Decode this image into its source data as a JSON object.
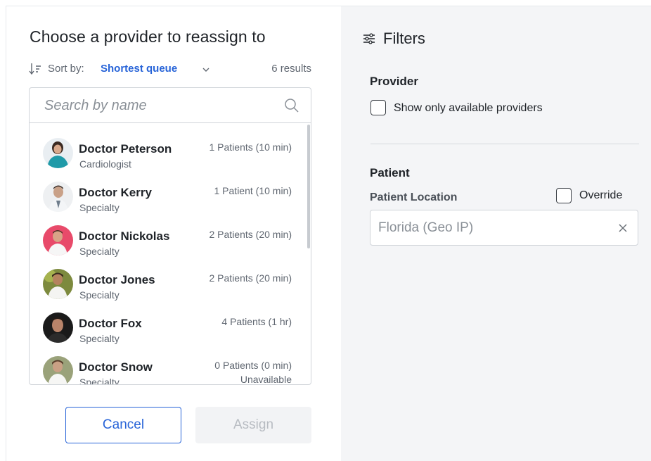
{
  "dialog": {
    "title": "Choose a provider to reassign to",
    "sort": {
      "label": "Sort by:",
      "value": "Shortest queue",
      "results": "6 results"
    },
    "search": {
      "placeholder": "Search by name",
      "value": ""
    },
    "providers": [
      {
        "name": "Doctor Peterson",
        "specialty": "Cardiologist",
        "queue": "1 Patients (10 min)",
        "status": ""
      },
      {
        "name": "Doctor Kerry",
        "specialty": "Specialty",
        "queue": "1 Patient (10 min)",
        "status": ""
      },
      {
        "name": "Doctor Nickolas",
        "specialty": "Specialty",
        "queue": "2 Patients (20 min)",
        "status": ""
      },
      {
        "name": "Doctor Jones",
        "specialty": "Specialty",
        "queue": "2 Patients (20 min)",
        "status": ""
      },
      {
        "name": "Doctor Fox",
        "specialty": "Specialty",
        "queue": "4 Patients (1 hr)",
        "status": ""
      },
      {
        "name": "Doctor Snow",
        "specialty": "Specialty",
        "queue": "0 Patients (0 min)",
        "status": "Unavailable"
      }
    ],
    "buttons": {
      "cancel": "Cancel",
      "assign": "Assign"
    }
  },
  "filters": {
    "title": "Filters",
    "provider": {
      "heading": "Provider",
      "available_only_label": "Show only available providers",
      "available_only_checked": false
    },
    "patient": {
      "heading": "Patient",
      "location_label": "Patient Location",
      "override_label": "Override",
      "override_checked": false,
      "location_value": "Florida (Geo IP)"
    }
  },
  "colors": {
    "accent": "#2864d8",
    "panel_bg": "#f4f5f7",
    "disabled_bg": "#f2f3f5",
    "disabled_text": "#b8bcc2"
  }
}
